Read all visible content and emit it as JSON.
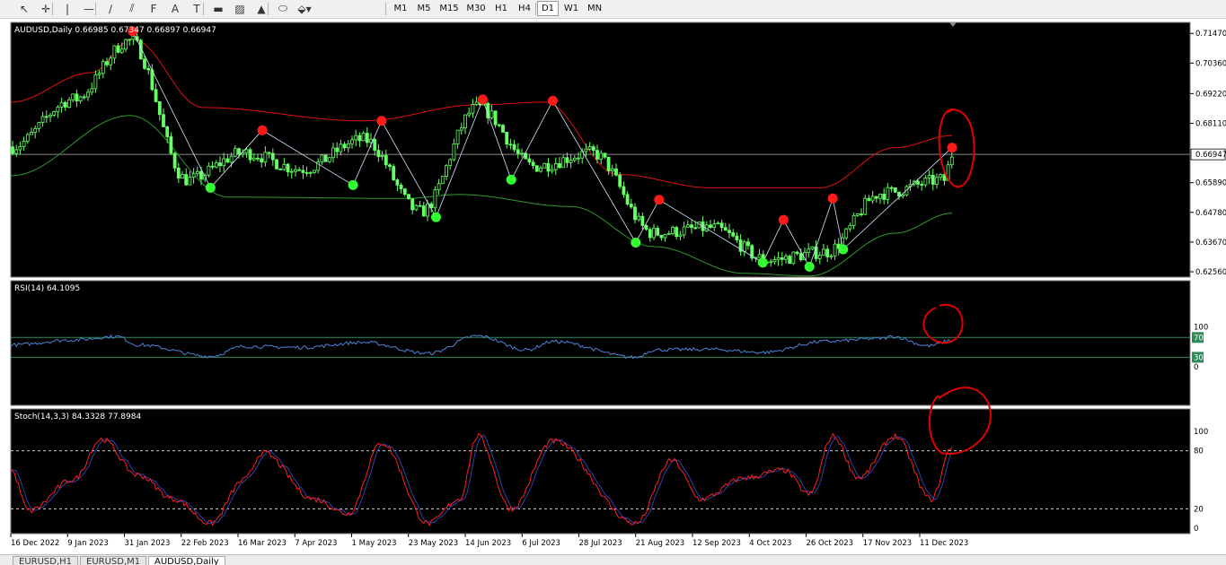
{
  "toolbar": {
    "tools": [
      {
        "name": "cursor-icon",
        "glyph": "↖"
      },
      {
        "name": "crosshair-icon",
        "glyph": "✛"
      },
      {
        "name": "vertical-line-icon",
        "glyph": "|"
      },
      {
        "name": "horizontal-line-icon",
        "glyph": "—"
      },
      {
        "name": "trendline-icon",
        "glyph": "∕"
      },
      {
        "name": "channel-icon",
        "glyph": "⫽"
      },
      {
        "name": "fibonacci-icon",
        "glyph": "F"
      },
      {
        "name": "text-tool-icon",
        "glyph": "A"
      },
      {
        "name": "label-tool-icon",
        "glyph": "T"
      },
      {
        "name": "rectangle-icon",
        "glyph": "▬"
      },
      {
        "name": "cycle-lines-icon",
        "glyph": "▨"
      },
      {
        "name": "triangle-icon",
        "glyph": "▲"
      },
      {
        "name": "ellipse-icon",
        "glyph": "⬭"
      },
      {
        "name": "arrows-icon",
        "glyph": "⬙▾"
      }
    ],
    "timeframes": [
      "M1",
      "M5",
      "M15",
      "M30",
      "H1",
      "H4",
      "D1",
      "W1",
      "MN"
    ],
    "active_timeframe": "D1"
  },
  "main_chart": {
    "header": "AUDUSD,Daily  0.66985 0.67347 0.66897 0.66947",
    "price_labels": [
      "0.71470",
      "0.70360",
      "0.69220",
      "0.68110",
      "0.66947",
      "0.65890",
      "0.64780",
      "0.63670",
      "0.62560"
    ],
    "current_price": "0.66947"
  },
  "rsi_panel": {
    "header": "RSI(14) 64.1095",
    "scale_labels": [
      "100",
      "70",
      "30",
      "0"
    ]
  },
  "stoch_panel": {
    "header": "Stoch(14,3,3) 84.3328 77.8984",
    "scale_labels": [
      "100",
      "80",
      "20",
      "0"
    ]
  },
  "x_axis_labels": [
    "16 Dec 2022",
    "9 Jan 2023",
    "31 Jan 2023",
    "22 Feb 2023",
    "16 Mar 2023",
    "7 Apr 2023",
    "1 May 2023",
    "23 May 2023",
    "14 Jun 2023",
    "6 Jul 2023",
    "28 Jul 2023",
    "21 Aug 2023",
    "12 Sep 2023",
    "4 Oct 2023",
    "26 Oct 2023",
    "17 Nov 2023",
    "11 Dec 2023"
  ],
  "tabs": [
    "EURUSD,H1",
    "EURUSD,M1",
    "AUDUSD,Daily"
  ],
  "active_tab": "AUDUSD,Daily",
  "colors": {
    "background": "#000000",
    "candle": "#66ff66",
    "upper_band": "#e01010",
    "lower_band": "#2e9a2e",
    "zigzag": "#d0e4ff",
    "swing_high": "#ff1a1a",
    "swing_low": "#33ff33",
    "rsi_line": "#4e83d8",
    "stoch_main": "#ff2020",
    "stoch_signal": "#3040b0",
    "level_line": "#2e8b57",
    "annotation": "#e00000"
  },
  "chart_data": {
    "type": "candlestick",
    "symbol": "AUDUSD",
    "timeframe": "Daily",
    "last_bar": {
      "open": 0.66985,
      "high": 0.67347,
      "low": 0.66897,
      "close": 0.66947
    },
    "x_range": [
      "2022-12-16",
      "2023-12-14"
    ],
    "price_range": [
      0.6236,
      0.7188
    ],
    "price_path": [
      [
        "2022-12-16",
        0.6723
      ],
      [
        "2023-01-09",
        0.69
      ],
      [
        "2023-01-31",
        0.712
      ],
      [
        "2023-02-22",
        0.66
      ],
      [
        "2023-03-16",
        0.67
      ],
      [
        "2023-04-07",
        0.664
      ],
      [
        "2023-05-01",
        0.675
      ],
      [
        "2023-05-23",
        0.648
      ],
      [
        "2023-06-14",
        0.687
      ],
      [
        "2023-07-06",
        0.665
      ],
      [
        "2023-07-28",
        0.67
      ],
      [
        "2023-08-21",
        0.64
      ],
      [
        "2023-09-12",
        0.642
      ],
      [
        "2023-10-04",
        0.63
      ],
      [
        "2023-10-26",
        0.633
      ],
      [
        "2023-11-17",
        0.655
      ],
      [
        "2023-12-11",
        0.66
      ],
      [
        "2023-12-14",
        0.6695
      ]
    ],
    "swing_highs": [
      [
        "2023-02-01",
        0.7155
      ],
      [
        "2023-03-23",
        0.6785
      ],
      [
        "2023-05-08",
        0.682
      ],
      [
        "2023-06-16",
        0.69
      ],
      [
        "2023-07-13",
        0.6895
      ],
      [
        "2023-08-23",
        0.6525
      ],
      [
        "2023-10-10",
        0.645
      ],
      [
        "2023-10-29",
        0.653
      ],
      [
        "2023-12-14",
        0.672
      ]
    ],
    "swing_lows": [
      [
        "2023-03-03",
        0.657
      ],
      [
        "2023-04-27",
        0.658
      ],
      [
        "2023-05-29",
        0.646
      ],
      [
        "2023-06-27",
        0.66
      ],
      [
        "2023-08-14",
        0.6365
      ],
      [
        "2023-10-02",
        0.629
      ],
      [
        "2023-10-20",
        0.6275
      ],
      [
        "2023-11-02",
        0.634
      ]
    ],
    "upper_band": [
      [
        "2022-12-16",
        0.689
      ],
      [
        "2023-01-16",
        0.7
      ],
      [
        "2023-02-01",
        0.7125
      ],
      [
        "2023-02-28",
        0.687
      ],
      [
        "2023-05-01",
        0.682
      ],
      [
        "2023-06-14",
        0.688
      ],
      [
        "2023-07-10",
        0.689
      ],
      [
        "2023-08-07",
        0.662
      ],
      [
        "2023-09-12",
        0.657
      ],
      [
        "2023-10-24",
        0.657
      ],
      [
        "2023-11-22",
        0.672
      ],
      [
        "2023-12-14",
        0.6765
      ]
    ],
    "lower_band": [
      [
        "2022-12-16",
        0.6615
      ],
      [
        "2023-01-31",
        0.684
      ],
      [
        "2023-03-10",
        0.6535
      ],
      [
        "2023-05-17",
        0.653
      ],
      [
        "2023-06-07",
        0.6545
      ],
      [
        "2023-07-20",
        0.65
      ],
      [
        "2023-08-21",
        0.635
      ],
      [
        "2023-09-25",
        0.625
      ],
      [
        "2023-10-20",
        0.624
      ],
      [
        "2023-11-22",
        0.64
      ],
      [
        "2023-12-14",
        0.6475
      ]
    ],
    "rsi": {
      "range": [
        0,
        100
      ],
      "levels": [
        70,
        30
      ],
      "current": 64.1095,
      "path": [
        [
          "2022-12-16",
          55
        ],
        [
          "2023-01-09",
          65
        ],
        [
          "2023-01-26",
          72
        ],
        [
          "2023-02-03",
          55
        ],
        [
          "2023-03-03",
          32
        ],
        [
          "2023-03-16",
          52
        ],
        [
          "2023-04-07",
          50
        ],
        [
          "2023-05-01",
          60
        ],
        [
          "2023-05-26",
          38
        ],
        [
          "2023-06-14",
          73
        ],
        [
          "2023-07-03",
          45
        ],
        [
          "2023-07-13",
          62
        ],
        [
          "2023-08-14",
          30
        ],
        [
          "2023-08-21",
          45
        ],
        [
          "2023-09-12",
          46
        ],
        [
          "2023-10-02",
          40
        ],
        [
          "2023-10-26",
          62
        ],
        [
          "2023-11-17",
          68
        ],
        [
          "2023-11-21",
          72
        ],
        [
          "2023-12-05",
          53
        ],
        [
          "2023-12-14",
          64
        ]
      ]
    },
    "stochastic": {
      "range": [
        0,
        100
      ],
      "levels": [
        80,
        20
      ],
      "main_current": 84.3328,
      "signal_current": 77.8984,
      "main_path": [
        [
          "2022-12-16",
          60
        ],
        [
          "2022-12-23",
          18
        ],
        [
          "2023-01-09",
          50
        ],
        [
          "2023-01-20",
          92
        ],
        [
          "2023-02-03",
          55
        ],
        [
          "2023-02-17",
          30
        ],
        [
          "2023-03-03",
          5
        ],
        [
          "2023-03-16",
          50
        ],
        [
          "2023-03-23",
          78
        ],
        [
          "2023-04-12",
          30
        ],
        [
          "2023-04-25",
          15
        ],
        [
          "2023-05-08",
          88
        ],
        [
          "2023-05-26",
          5
        ],
        [
          "2023-06-07",
          30
        ],
        [
          "2023-06-14",
          95
        ],
        [
          "2023-06-27",
          20
        ],
        [
          "2023-07-13",
          90
        ],
        [
          "2023-08-14",
          5
        ],
        [
          "2023-08-28",
          70
        ],
        [
          "2023-09-08",
          30
        ],
        [
          "2023-09-25",
          52
        ],
        [
          "2023-10-10",
          60
        ],
        [
          "2023-10-20",
          35
        ],
        [
          "2023-10-29",
          95
        ],
        [
          "2023-11-08",
          52
        ],
        [
          "2023-11-22",
          95
        ],
        [
          "2023-12-06",
          30
        ],
        [
          "2023-12-14",
          84
        ]
      ]
    }
  }
}
